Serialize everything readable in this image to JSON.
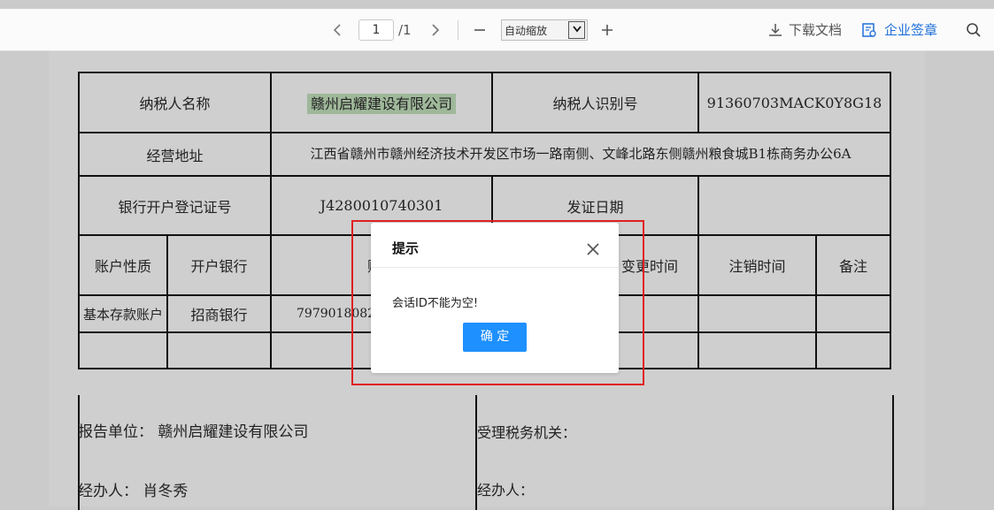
{
  "toolbar": {
    "prev_icon": "chevron-left-icon",
    "current_page": "1",
    "total_pages": "/1",
    "next_icon": "chevron-right-icon",
    "zoom_out": "—",
    "zoom_mode": "自动缩放",
    "zoom_in": "+",
    "download_label": "下载文档",
    "sign_label": "企业签章",
    "search_icon": "search-icon"
  },
  "form": {
    "taxpayer_name_label": "纳税人名称",
    "taxpayer_name": "赣州启耀建设有限公司",
    "taxpayer_id_label": "纳税人识别号",
    "taxpayer_id": "91360703MACK0Y8G18",
    "address_label": "经营地址",
    "address": "江西省赣州市赣州经济技术开发区市场一路南侧、文峰北路东侧赣州粮食城B1栋商务办公6A",
    "bank_reg_label": "银行开户登记证号",
    "bank_reg_no": "J4280010740301",
    "issue_date_label": "发证日期",
    "issue_date": "",
    "col_account_type": "账户性质",
    "col_bank": "开户银行",
    "col_account_no": "账号",
    "col_change_time": "变更时间",
    "col_cancel_time": "注销时间",
    "col_remark": "备注",
    "row1_type": "基本存款账户",
    "row1_bank": "招商银行",
    "row1_account": "7979018082"
  },
  "bottom": {
    "report_unit": "报告单位：  赣州启耀建设有限公司",
    "handler_left": "经办人：  肖冬秀",
    "tax_office": "受理税务机关：",
    "handler_right": "经办人："
  },
  "dialog": {
    "title": "提示",
    "message": "会话ID不能为空!",
    "ok_label": "确 定"
  },
  "colors": {
    "highlight": "#9fb89a",
    "primary_button": "#1e90ff",
    "annotation_box": "#e02020"
  }
}
